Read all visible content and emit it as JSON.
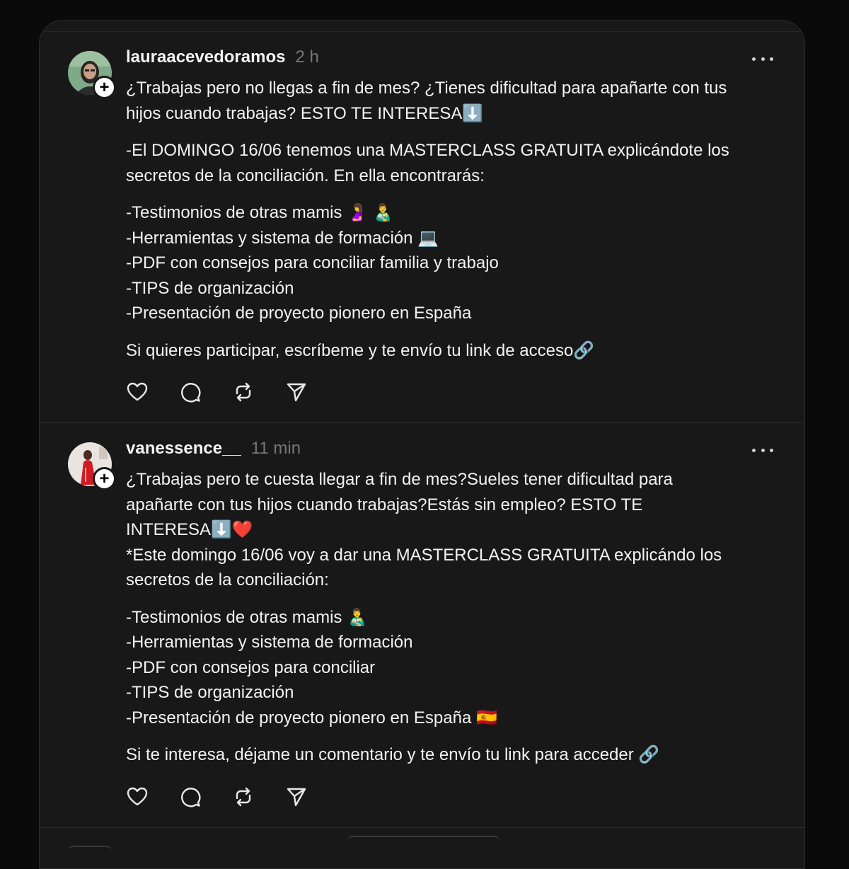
{
  "posts": [
    {
      "username": "lauraacevedoramos",
      "time": "2 h",
      "paragraphs": [
        [
          "¿Trabajas pero no llegas a fin de mes? ¿Tienes dificultad para apañarte con tus",
          "hijos cuando trabajas? ESTO TE INTERESA⬇️"
        ],
        [
          "-El DOMINGO 16/06 tenemos una MASTERCLASS GRATUITA explicándote los",
          "secretos de la conciliación. En ella encontrarás:"
        ],
        [
          "-Testimonios de otras mamis 🤰 👨‍🍼",
          "-Herramientas y sistema de formación 💻",
          "-PDF con consejos para conciliar familia y trabajo",
          "-TIPS de organización",
          "-Presentación de proyecto pionero en España"
        ],
        [
          "Si quieres participar, escríbeme y te envío tu link de acceso🔗"
        ]
      ]
    },
    {
      "username": "vanessence__",
      "time": "11 min",
      "paragraphs": [
        [
          "¿Trabajas pero te cuesta llegar a fin de mes?Sueles tener dificultad para",
          "apañarte con tus hijos cuando trabajas?Estás sin empleo? ESTO TE",
          "INTERESA⬇️❤️",
          "*Este domingo 16/06 voy a dar una MASTERCLASS GRATUITA explicándo los",
          "secretos de la conciliación:"
        ],
        [
          "-Testimonios de otras mamis 👨‍🍼",
          "-Herramientas y sistema de formación",
          "-PDF con consejos para conciliar",
          "-TIPS de organización",
          "-Presentación de proyecto pionero en España 🇪🇸"
        ],
        [
          "Si te interesa, déjame un comentario y te envío tu link para acceder 🔗"
        ]
      ]
    }
  ],
  "icons": {
    "like": "heart-icon",
    "comment": "comment-icon",
    "repost": "repost-icon",
    "share": "send-icon",
    "more": "more-icon",
    "follow": "plus-icon"
  },
  "colors": {
    "background": "#0a0a0a",
    "card": "#181818",
    "text": "#f3f3f3",
    "muted": "#777777"
  }
}
